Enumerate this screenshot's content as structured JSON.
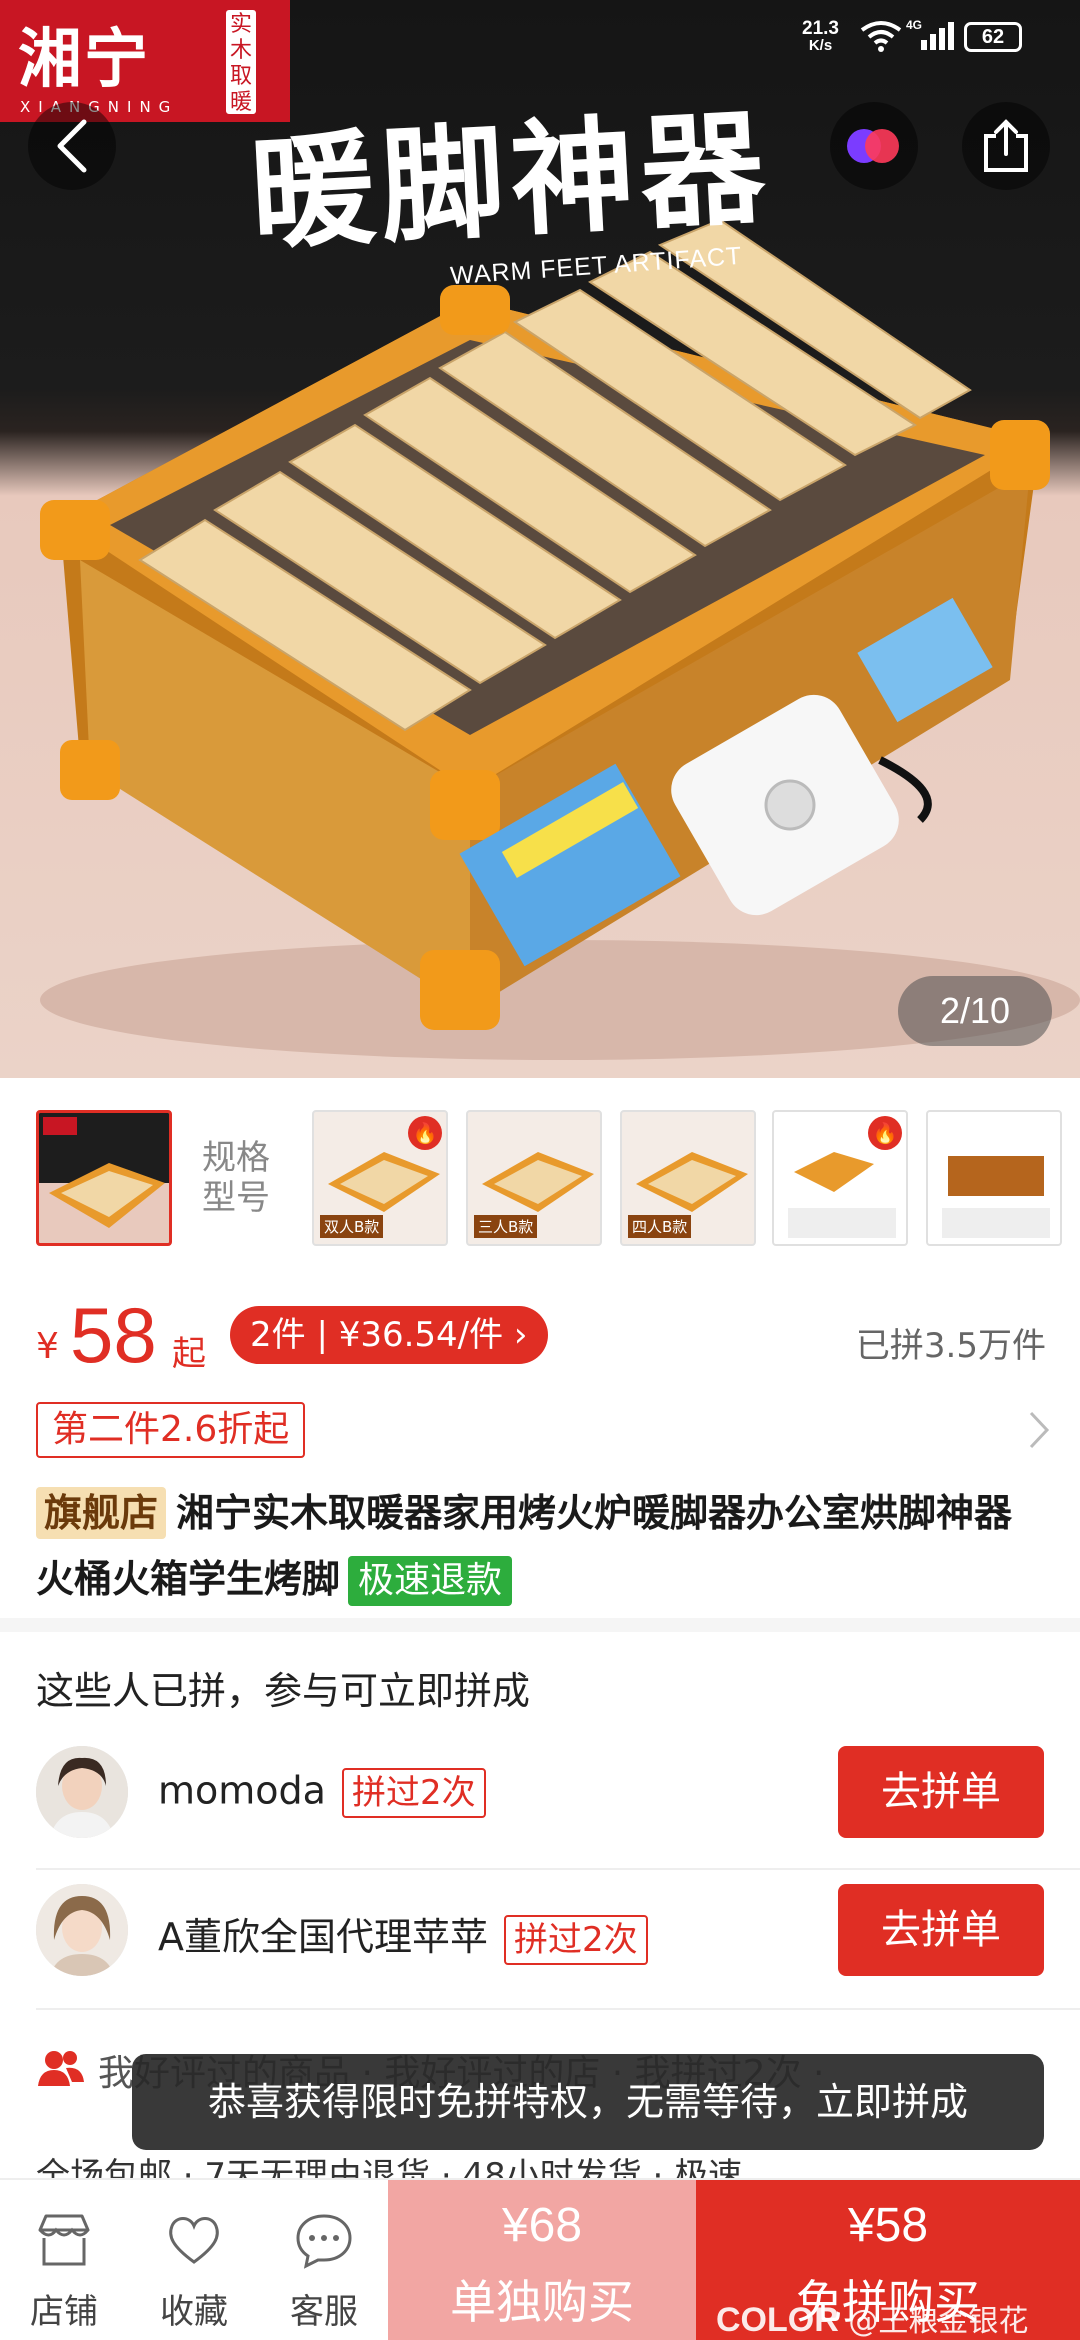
{
  "status_bar": {
    "speed": "21.3",
    "speed_unit": "K/s",
    "network": "4G",
    "battery": "62"
  },
  "hero": {
    "brand_cn": "湘宁",
    "brand_en": "XIANGNING",
    "brand_stamp": "实木取暖",
    "headline": "暖脚神器",
    "subheadline": "WARM FEET ARTIFACT",
    "counter": "2/10"
  },
  "thumbnails": {
    "spec_label": "规格型号",
    "items": [
      {
        "caption": "",
        "hot": false
      },
      {
        "caption": "双人B款",
        "hot": true
      },
      {
        "caption": "三人B款",
        "hot": false
      },
      {
        "caption": "四人B款",
        "hot": false
      },
      {
        "caption": "",
        "hot": true
      },
      {
        "caption": "",
        "hot": false
      }
    ]
  },
  "price": {
    "currency": "¥",
    "amount": "58",
    "suffix": "起",
    "multi_buy": "2件 | ¥36.54/件 ›",
    "sold": "已拼3.5万件"
  },
  "coupon": "第二件2.6折起",
  "title": {
    "tag_flagship": "旗舰店",
    "text": "湘宁实木取暖器家用烤火炉暖脚器办公室烘脚神器火桶火箱学生烤脚",
    "tag_refund": "极速退款"
  },
  "group_buy": {
    "heading": "这些人已拼，参与可立即拼成",
    "rows": [
      {
        "name": "momoda",
        "times": "拼过2次",
        "button": "去拼单"
      },
      {
        "name": "A董欣全国代理苹苹",
        "times": "拼过2次",
        "button": "去拼单"
      }
    ]
  },
  "review_row": "我好评过的商品 · 我好评过的店 · 我拼过2次 ·",
  "service_row": "全场包邮 · 7天无理由退货 · 48小时发货 · 极速",
  "toast": "恭喜获得限时免拼特权，无需等待，立即拼成",
  "bottom_bar": {
    "tabs": [
      "店铺",
      "收藏",
      "客服"
    ],
    "solo_price": "¥68",
    "solo_label": "单独购买",
    "group_price": "¥58",
    "group_label": "免拼购买"
  },
  "watermark": {
    "brand": "COLOR",
    "user": "@王粮金银花"
  },
  "colors": {
    "accent": "#e02e24",
    "solo_button": "#f2a6a3",
    "refund_tag": "#2dad3d",
    "flagship_tag": "#f6dfb2"
  }
}
